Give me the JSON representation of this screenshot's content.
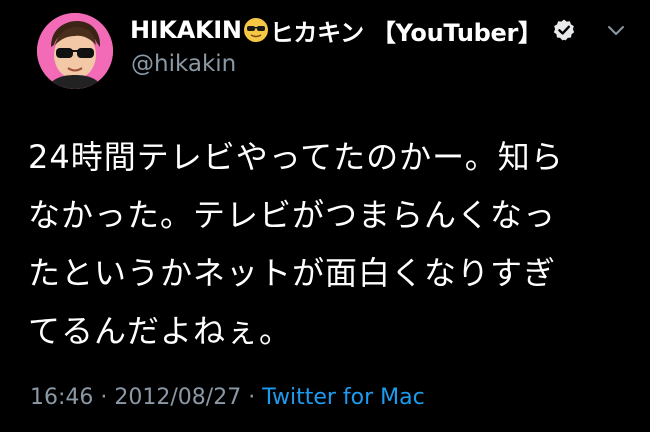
{
  "tweet": {
    "author": {
      "display_name": "HIKAKIN",
      "emoji_icon": "sunglasses-emoji-icon",
      "display_name_suffix": "ヒカキン 【YouTuber】",
      "verified_icon": "verified-badge-icon",
      "handle": "@hikakin",
      "avatar_icon": "profile-avatar"
    },
    "menu_icon": "chevron-down-icon",
    "body_lines": [
      "24時間テレビやってたのかー。知ら",
      "なかった。テレビがつまらんくなっ",
      "たというかネットが面白くなりすぎ",
      "てるんだよねぇ。"
    ],
    "meta": {
      "time": "16:46",
      "separator": " · ",
      "date": "2012/08/27",
      "source": "Twitter for Mac"
    }
  },
  "colors": {
    "background": "#000000",
    "text": "#ffffff",
    "secondary_text": "#8b98a5",
    "link": "#1d9bf0",
    "avatar_bg": "#f36bb6"
  }
}
